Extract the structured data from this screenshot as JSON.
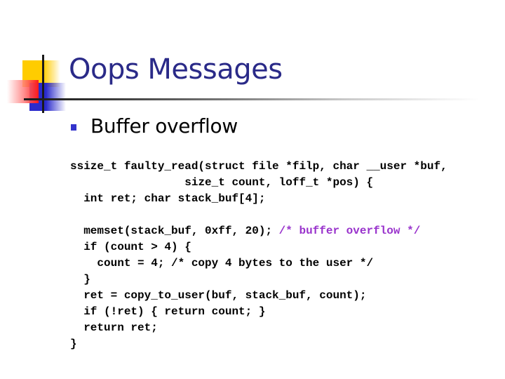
{
  "slide": {
    "title": "Oops Messages",
    "bullets": [
      {
        "text": "Buffer overflow"
      }
    ],
    "accent_colors": {
      "title": "#2a2a88",
      "bullet": "#3333cc",
      "comment": "#9933cc",
      "deco_yellow": "#ffcc00",
      "deco_blue": "#2b2bcc",
      "deco_red": "#ff1a1a"
    },
    "code": {
      "lines": [
        {
          "indent": "",
          "code": "ssize_t faulty_read(struct file *filp, char __user *buf,",
          "comment": ""
        },
        {
          "indent": "                 ",
          "code": "size_t count, loff_t *pos) {",
          "comment": ""
        },
        {
          "indent": "  ",
          "code": "int ret; char stack_buf[4];",
          "comment": ""
        },
        {
          "indent": "",
          "code": "",
          "comment": ""
        },
        {
          "indent": "  ",
          "code": "memset(stack_buf, 0xff, 20); ",
          "comment": "/* buffer overflow */"
        },
        {
          "indent": "  ",
          "code": "if (count > 4) {",
          "comment": ""
        },
        {
          "indent": "    ",
          "code": "count = 4; /* copy 4 bytes to the user */",
          "comment": ""
        },
        {
          "indent": "  ",
          "code": "}",
          "comment": ""
        },
        {
          "indent": "  ",
          "code": "ret = copy_to_user(buf, stack_buf, count);",
          "comment": ""
        },
        {
          "indent": "  ",
          "code": "if (!ret) { return count; }",
          "comment": ""
        },
        {
          "indent": "  ",
          "code": "return ret;",
          "comment": ""
        },
        {
          "indent": "",
          "code": "}",
          "comment": ""
        }
      ]
    }
  }
}
